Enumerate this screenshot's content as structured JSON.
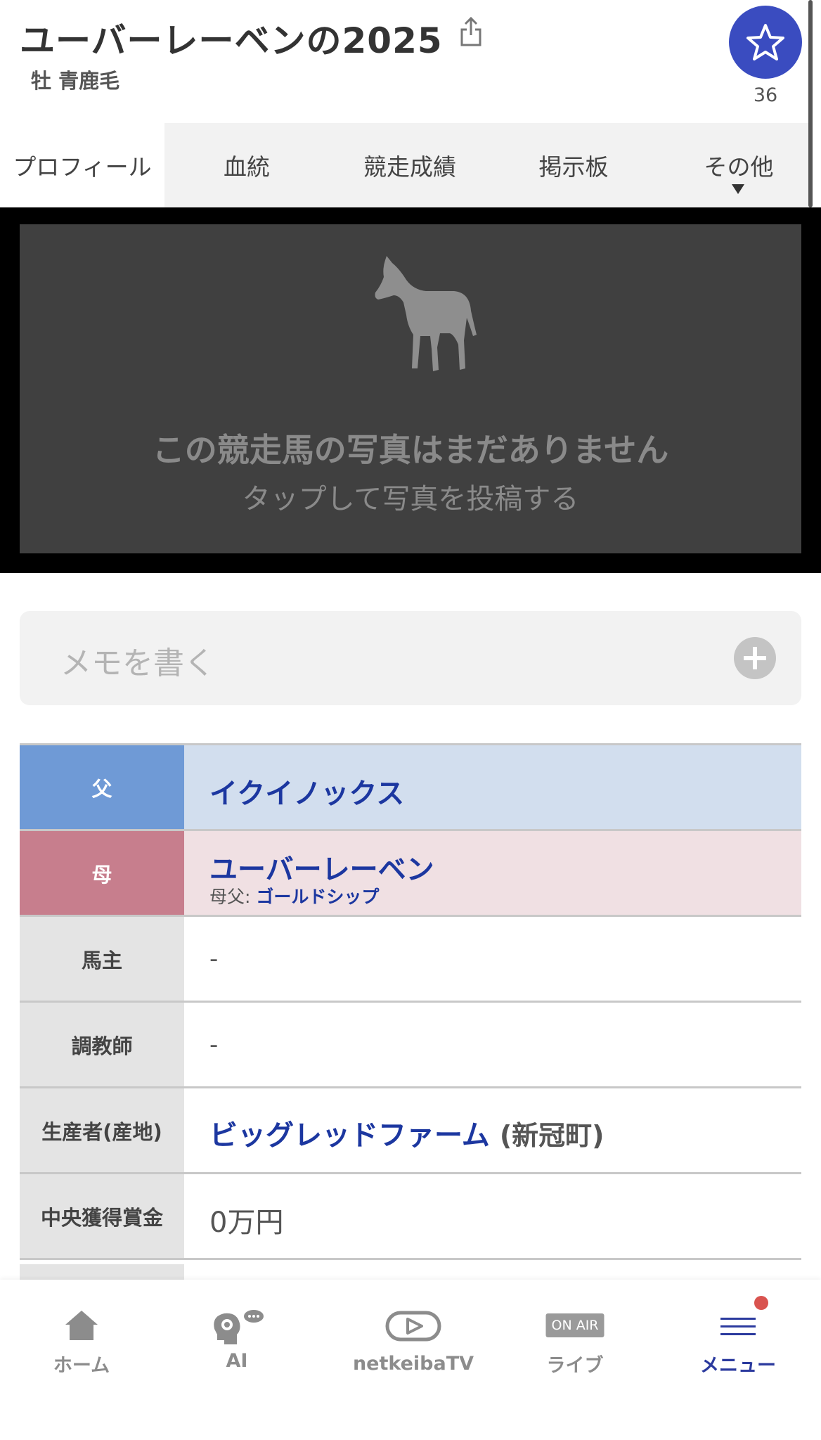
{
  "header": {
    "title": "ユーバーレーベンの2025",
    "subtitle": "牡 青鹿毛",
    "favorite_count": "36",
    "accent_color": "#3a4cc0"
  },
  "tabs": [
    {
      "label": "プロフィール",
      "active": true
    },
    {
      "label": "血統",
      "active": false
    },
    {
      "label": "競走成績",
      "active": false
    },
    {
      "label": "掲示板",
      "active": false
    },
    {
      "label": "その他",
      "active": false
    }
  ],
  "photo": {
    "message": "この競走馬の写真はまだありません",
    "sub_message": "タップして写真を投稿する",
    "icon": "horse-silhouette-icon"
  },
  "memo": {
    "placeholder": "メモを書く",
    "icon": "plus-circle-icon"
  },
  "profile": {
    "father_label": "父",
    "father_value": "イクイノックス",
    "mother_label": "母",
    "mother_value": "ユーバーレーベン",
    "mother_sire_label": "母父:",
    "mother_sire_value": "ゴールドシップ",
    "owner_label": "馬主",
    "owner_value": "-",
    "trainer_label": "調教師",
    "trainer_value": "-",
    "breeder_label": "生産者(産地)",
    "breeder_value": "ビッグレッドファーム",
    "breeder_area": "(新冠町)",
    "prize_label": "中央獲得賞金",
    "prize_value": "0万円"
  },
  "bottom_nav": [
    {
      "label": "ホーム",
      "icon": "home-icon"
    },
    {
      "label": "AI",
      "icon": "ai-brain-icon"
    },
    {
      "label": "netkeibaTV",
      "icon": "play-tv-icon"
    },
    {
      "label": "ライブ",
      "icon": "on-air-icon",
      "icon_text": "ON AIR"
    },
    {
      "label": "メニュー",
      "icon": "menu-icon",
      "active": true
    }
  ]
}
